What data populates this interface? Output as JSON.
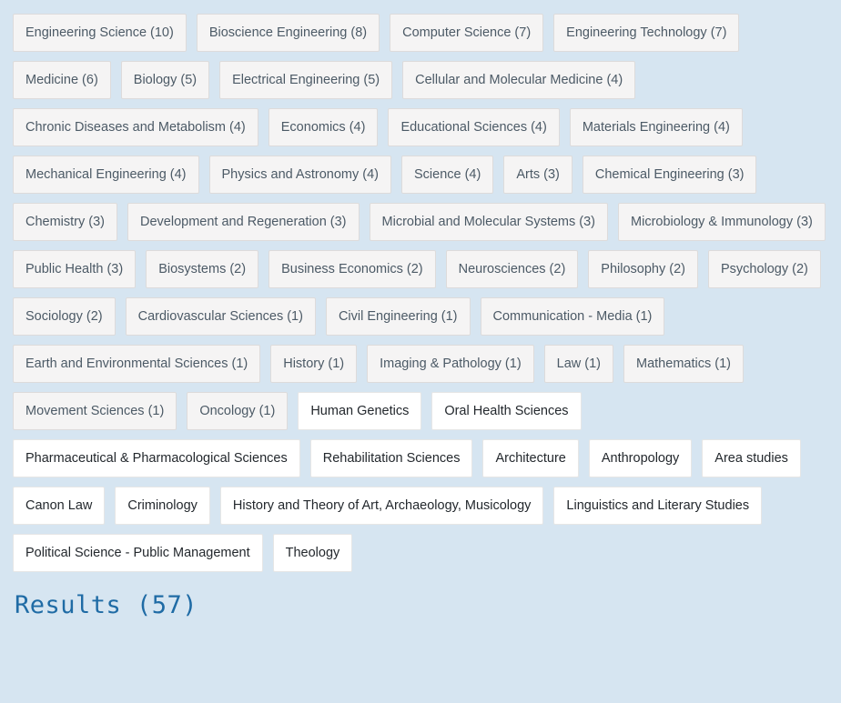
{
  "colors": {
    "page_background": "#d6e5f1",
    "counted_facet_background": "#f5f4f4",
    "counted_facet_border": "#dddbdb",
    "counted_facet_text": "#4c5a66",
    "plain_facet_background": "#ffffff",
    "plain_facet_border": "#e6e6e6",
    "plain_facet_text": "#23282d",
    "results_heading_text": "#1f6ba5"
  },
  "facets": {
    "items": [
      {
        "label": "Engineering Science (10)",
        "name": "engineering-science",
        "count": 10,
        "style": "counted"
      },
      {
        "label": "Bioscience Engineering (8)",
        "name": "bioscience-engineering",
        "count": 8,
        "style": "counted"
      },
      {
        "label": "Computer Science (7)",
        "name": "computer-science",
        "count": 7,
        "style": "counted"
      },
      {
        "label": "Engineering Technology (7)",
        "name": "engineering-technology",
        "count": 7,
        "style": "counted"
      },
      {
        "label": "Medicine (6)",
        "name": "medicine",
        "count": 6,
        "style": "counted"
      },
      {
        "label": "Biology (5)",
        "name": "biology",
        "count": 5,
        "style": "counted"
      },
      {
        "label": "Electrical Engineering (5)",
        "name": "electrical-engineering",
        "count": 5,
        "style": "counted"
      },
      {
        "label": "Cellular and Molecular Medicine (4)",
        "name": "cellular-and-molecular-medicine",
        "count": 4,
        "style": "counted"
      },
      {
        "label": "Chronic Diseases and Metabolism (4)",
        "name": "chronic-diseases-and-metabolism",
        "count": 4,
        "style": "counted"
      },
      {
        "label": "Economics (4)",
        "name": "economics",
        "count": 4,
        "style": "counted"
      },
      {
        "label": "Educational Sciences (4)",
        "name": "educational-sciences",
        "count": 4,
        "style": "counted"
      },
      {
        "label": "Materials Engineering (4)",
        "name": "materials-engineering",
        "count": 4,
        "style": "counted"
      },
      {
        "label": "Mechanical Engineering (4)",
        "name": "mechanical-engineering",
        "count": 4,
        "style": "counted"
      },
      {
        "label": "Physics and Astronomy (4)",
        "name": "physics-and-astronomy",
        "count": 4,
        "style": "counted"
      },
      {
        "label": "Science (4)",
        "name": "science",
        "count": 4,
        "style": "counted"
      },
      {
        "label": "Arts (3)",
        "name": "arts",
        "count": 3,
        "style": "counted"
      },
      {
        "label": "Chemical Engineering (3)",
        "name": "chemical-engineering",
        "count": 3,
        "style": "counted"
      },
      {
        "label": "Chemistry (3)",
        "name": "chemistry",
        "count": 3,
        "style": "counted"
      },
      {
        "label": "Development and Regeneration (3)",
        "name": "development-and-regeneration",
        "count": 3,
        "style": "counted"
      },
      {
        "label": "Microbial and Molecular Systems (3)",
        "name": "microbial-and-molecular-systems",
        "count": 3,
        "style": "counted"
      },
      {
        "label": "Microbiology & Immunology (3)",
        "name": "microbiology-and-immunology",
        "count": 3,
        "style": "counted"
      },
      {
        "label": "Public Health (3)",
        "name": "public-health",
        "count": 3,
        "style": "counted"
      },
      {
        "label": "Biosystems (2)",
        "name": "biosystems",
        "count": 2,
        "style": "counted"
      },
      {
        "label": "Business Economics (2)",
        "name": "business-economics",
        "count": 2,
        "style": "counted"
      },
      {
        "label": "Neurosciences (2)",
        "name": "neurosciences",
        "count": 2,
        "style": "counted"
      },
      {
        "label": "Philosophy (2)",
        "name": "philosophy",
        "count": 2,
        "style": "counted"
      },
      {
        "label": "Psychology (2)",
        "name": "psychology",
        "count": 2,
        "style": "counted"
      },
      {
        "label": "Sociology (2)",
        "name": "sociology",
        "count": 2,
        "style": "counted"
      },
      {
        "label": "Cardiovascular Sciences (1)",
        "name": "cardiovascular-sciences",
        "count": 1,
        "style": "counted"
      },
      {
        "label": "Civil Engineering (1)",
        "name": "civil-engineering",
        "count": 1,
        "style": "counted"
      },
      {
        "label": "Communication - Media (1)",
        "name": "communication-media",
        "count": 1,
        "style": "counted"
      },
      {
        "label": "Earth and Environmental Sciences (1)",
        "name": "earth-and-environmental-sciences",
        "count": 1,
        "style": "counted"
      },
      {
        "label": "History (1)",
        "name": "history",
        "count": 1,
        "style": "counted"
      },
      {
        "label": "Imaging & Pathology (1)",
        "name": "imaging-and-pathology",
        "count": 1,
        "style": "counted"
      },
      {
        "label": "Law (1)",
        "name": "law",
        "count": 1,
        "style": "counted"
      },
      {
        "label": "Mathematics (1)",
        "name": "mathematics",
        "count": 1,
        "style": "counted"
      },
      {
        "label": "Movement Sciences (1)",
        "name": "movement-sciences",
        "count": 1,
        "style": "counted"
      },
      {
        "label": "Oncology (1)",
        "name": "oncology",
        "count": 1,
        "style": "counted"
      },
      {
        "label": "Human Genetics",
        "name": "human-genetics",
        "count": null,
        "style": "plain"
      },
      {
        "label": "Oral Health Sciences",
        "name": "oral-health-sciences",
        "count": null,
        "style": "plain"
      },
      {
        "label": "Pharmaceutical & Pharmacological Sciences",
        "name": "pharmaceutical-and-pharmacological-sciences",
        "count": null,
        "style": "plain"
      },
      {
        "label": "Rehabilitation Sciences",
        "name": "rehabilitation-sciences",
        "count": null,
        "style": "plain"
      },
      {
        "label": "Architecture",
        "name": "architecture",
        "count": null,
        "style": "plain"
      },
      {
        "label": "Anthropology",
        "name": "anthropology",
        "count": null,
        "style": "plain"
      },
      {
        "label": "Area studies",
        "name": "area-studies",
        "count": null,
        "style": "plain"
      },
      {
        "label": "Canon Law",
        "name": "canon-law",
        "count": null,
        "style": "plain"
      },
      {
        "label": "Criminology",
        "name": "criminology",
        "count": null,
        "style": "plain"
      },
      {
        "label": "History and Theory of Art, Archaeology, Musicology",
        "name": "history-and-theory-of-art-archaeology-musicology",
        "count": null,
        "style": "plain"
      },
      {
        "label": "Linguistics and Literary Studies",
        "name": "linguistics-and-literary-studies",
        "count": null,
        "style": "plain"
      },
      {
        "label": "Political Science - Public Management",
        "name": "political-science-public-management",
        "count": null,
        "style": "plain"
      },
      {
        "label": "Theology",
        "name": "theology",
        "count": null,
        "style": "plain"
      }
    ]
  },
  "results": {
    "heading": "Results (57)",
    "count": 57
  }
}
